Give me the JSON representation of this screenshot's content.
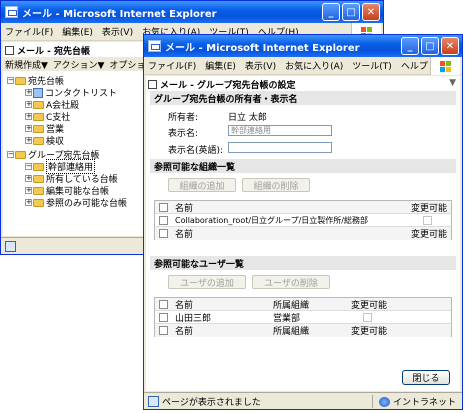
{
  "back_window": {
    "title": "メール - Microsoft Internet Explorer",
    "menu": [
      "ファイル(F)",
      "編集(E)",
      "表示(V)",
      "お気に入り(A)",
      "ツール(T)",
      "ヘルプ(H)"
    ],
    "panel_title": "メール - 宛先台帳",
    "toolbar": [
      "新規作成▼",
      "アクション▼",
      "オプショ"
    ],
    "tree": {
      "root": "宛先台帳",
      "root_children": [
        "コンタクトリスト",
        "A会社殿",
        "C支社",
        "営業",
        "検収"
      ],
      "group_root": "グループ宛先台帳",
      "group_children": [
        "幹部連絡用",
        "所有している台帳",
        "編集可能な台帳",
        "参照のみ可能な台帳"
      ]
    }
  },
  "front_window": {
    "title": "メール - Microsoft Internet Explorer",
    "menu": [
      "ファイル(F)",
      "編集(E)",
      "表示(V)",
      "お気に入り(A)",
      "ツール(T)",
      "ヘルプ"
    ],
    "menu_overflow": "»",
    "panel_title": "メール - グループ宛先台帳の設定",
    "owner_section": {
      "heading": "グループ宛先台帳の所有者・表示名",
      "owner_label": "所有者:",
      "owner_value": "日立 太郎",
      "display_name_label": "表示名:",
      "display_name_value": "幹部連絡用",
      "display_name_en_label": "表示名(英語):",
      "display_name_en_value": ""
    },
    "org_section": {
      "heading": "参照可能な組織一覧",
      "add_button": "組織の追加",
      "remove_button": "組織の削除",
      "columns": [
        "名前",
        "変更可能"
      ],
      "rows": [
        {
          "name": "Collaboration_root/日立グループ/日立製作所/総務部"
        }
      ],
      "footer_columns": [
        "名前",
        "変更可能"
      ]
    },
    "user_section": {
      "heading": "参照可能なユーザ一覧",
      "add_button": "ユーザの追加",
      "remove_button": "ユーザの削除",
      "columns": [
        "名前",
        "所属組織",
        "変更可能"
      ],
      "rows": [
        {
          "name": "山田三郎",
          "org": "営業部"
        }
      ],
      "footer_columns": [
        "名前",
        "所属組織",
        "変更可能"
      ]
    },
    "close_button": "閉じる",
    "status_text": "ページが表示されました",
    "zone_text": "イントラネット"
  }
}
